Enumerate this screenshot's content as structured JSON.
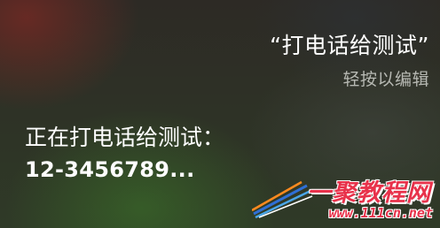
{
  "siri": {
    "query": "“打电话给测试”",
    "tap_hint": "轻按以编辑",
    "response_line": "正在打电话给测试：",
    "phone_number": "12-3456789..."
  },
  "watermark": {
    "brand": "一聚教程网",
    "url": "www.111cn.net"
  },
  "colors": {
    "text_primary": "#ffffff",
    "text_secondary": "#b7b9b3",
    "watermark_red": "#e8324b"
  }
}
